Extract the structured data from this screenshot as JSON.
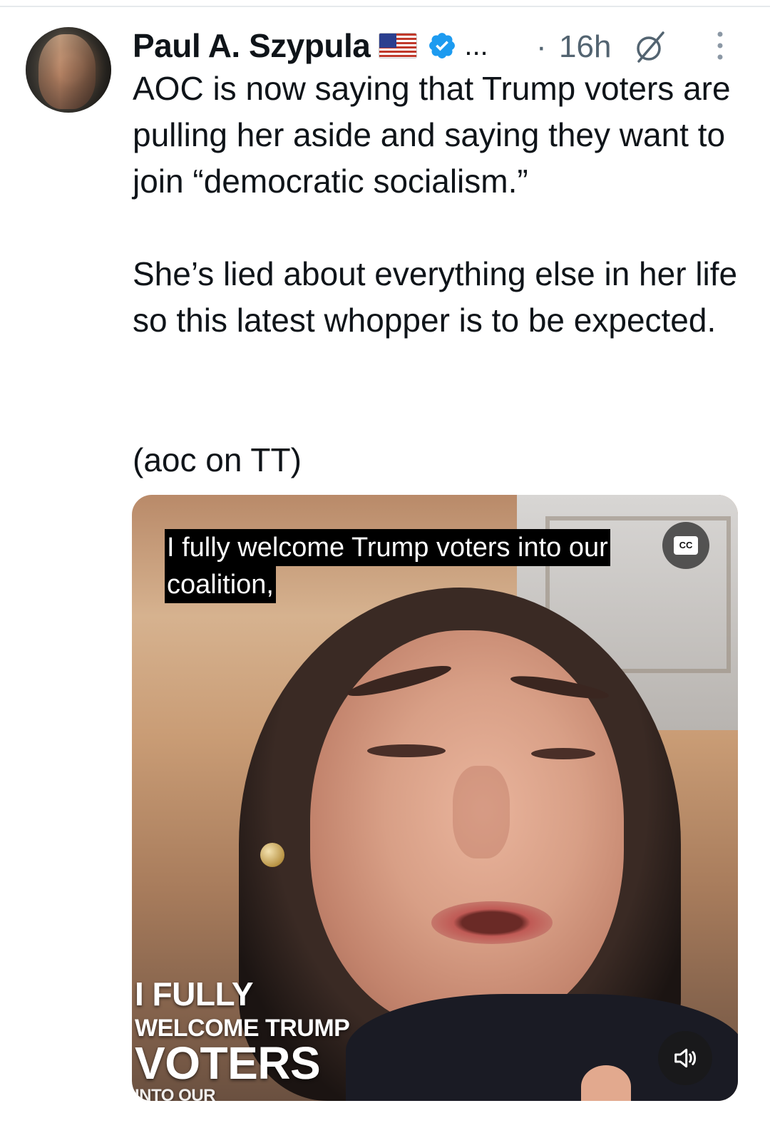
{
  "post": {
    "author_name": "Paul A. Szypula",
    "name_ellipsis": "...",
    "time_dot": "·",
    "timestamp": "16h",
    "icons": {
      "avatar": "avatar-photo",
      "flag": "us-flag-icon",
      "verified": "verified-badge-icon",
      "grok": "grok-icon",
      "more": "more-vertical-icon"
    },
    "paragraphs": [
      "AOC is now saying that Trump voters are pulling her aside and saying they want to join “democratic socialism.”",
      "She’s lied about everything else in her life so this latest whopper is to be expected.",
      "(aoc on TT)"
    ]
  },
  "media": {
    "caption_lines": [
      "I fully welcome Trump voters into our",
      "coalition,"
    ],
    "cc_label": "CC",
    "overlay_lines": [
      "I FULLY",
      "WELCOME TRUMP",
      "VOTERS",
      "INTO OUR"
    ],
    "sound_icon": "volume-icon"
  },
  "colors": {
    "verified_blue": "#1d9bf0",
    "secondary_text": "#536471",
    "primary_text": "#0f1419"
  }
}
